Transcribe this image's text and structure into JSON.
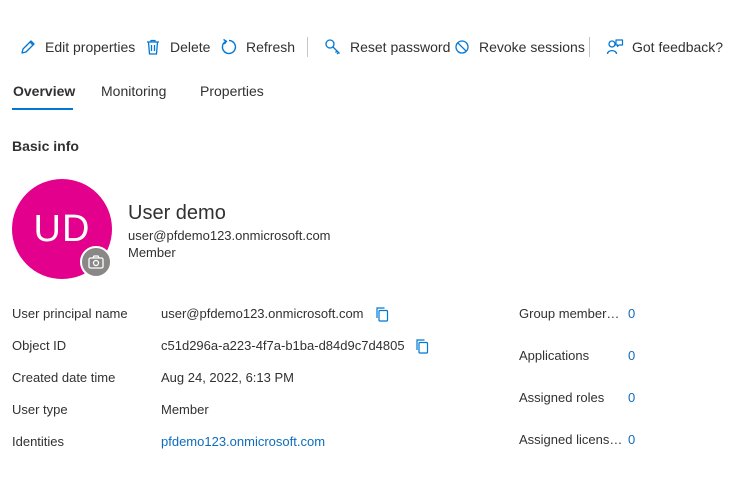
{
  "toolbar": {
    "edit_label": "Edit properties",
    "delete_label": "Delete",
    "refresh_label": "Refresh",
    "reset_label": "Reset password",
    "revoke_label": "Revoke sessions",
    "feedback_label": "Got feedback?"
  },
  "tabs": [
    {
      "label": "Overview",
      "active": true
    },
    {
      "label": "Monitoring",
      "active": false
    },
    {
      "label": "Properties",
      "active": false
    }
  ],
  "section_title": "Basic info",
  "user": {
    "initials": "UD",
    "display_name": "User demo",
    "upn": "user@pfdemo123.onmicrosoft.com",
    "type": "Member",
    "avatar_color": "#e3008c"
  },
  "details": [
    {
      "label": "User principal name",
      "value": "user@pfdemo123.onmicrosoft.com"
    },
    {
      "label": "Object ID",
      "value": "c51d296a-a223-4f7a-b1ba-d84d9c7d4805"
    },
    {
      "label": "Created date time",
      "value": "Aug 24, 2022, 6:13 PM"
    },
    {
      "label": "User type",
      "value": "Member"
    },
    {
      "label": "Identities",
      "value": "pfdemo123.onmicrosoft.com"
    }
  ],
  "stats": [
    {
      "label": "Group member…",
      "value": "0"
    },
    {
      "label": "Applications",
      "value": "0"
    },
    {
      "label": "Assigned roles",
      "value": "0"
    },
    {
      "label": "Assigned licens…",
      "value": "0"
    }
  ],
  "colors": {
    "accent": "#0078d4",
    "link": "#0f6cbd"
  }
}
